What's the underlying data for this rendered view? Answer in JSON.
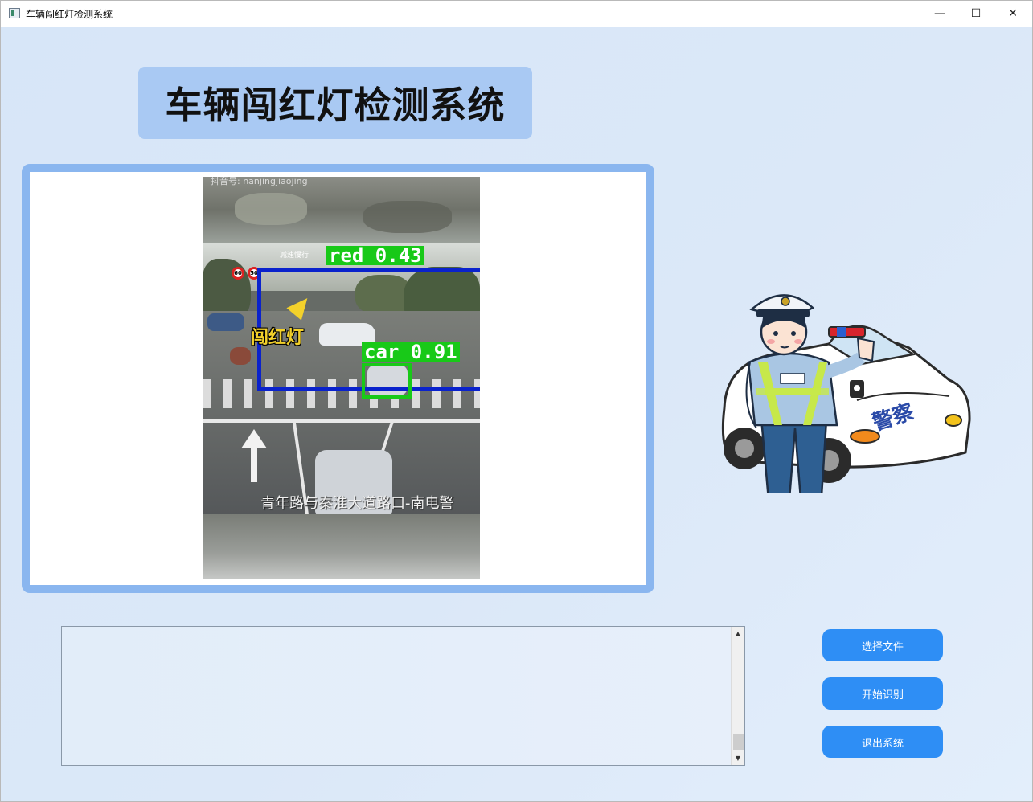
{
  "window": {
    "title": "车辆闯红灯检测系统",
    "controls": {
      "minimize": "—",
      "maximize": "☐",
      "close": "✕"
    }
  },
  "header": {
    "title": "车辆闯红灯检测系统"
  },
  "detection_image": {
    "watermark": "抖音号: nanjingjiaojing",
    "overlay_label": "闯红灯",
    "sign_label": "减速慢行",
    "caption": "青年路与秦淮大道路口-南电警",
    "speed_signs": [
      "60",
      "50"
    ],
    "detections": [
      {
        "label": "red 0.43",
        "color": "#18c918"
      },
      {
        "label": "car 0.91",
        "color": "#18c918"
      }
    ],
    "line_color": "#0a22cc"
  },
  "output_log": {
    "text": ""
  },
  "buttons": {
    "select_file": "选择文件",
    "start_detect": "开始识别",
    "exit_system": "退出系统"
  },
  "colors": {
    "accent": "#2e8ef5",
    "title_bg": "#a9c9f3",
    "frame_border": "#8ab6ef",
    "background": "#d7e6f8"
  }
}
